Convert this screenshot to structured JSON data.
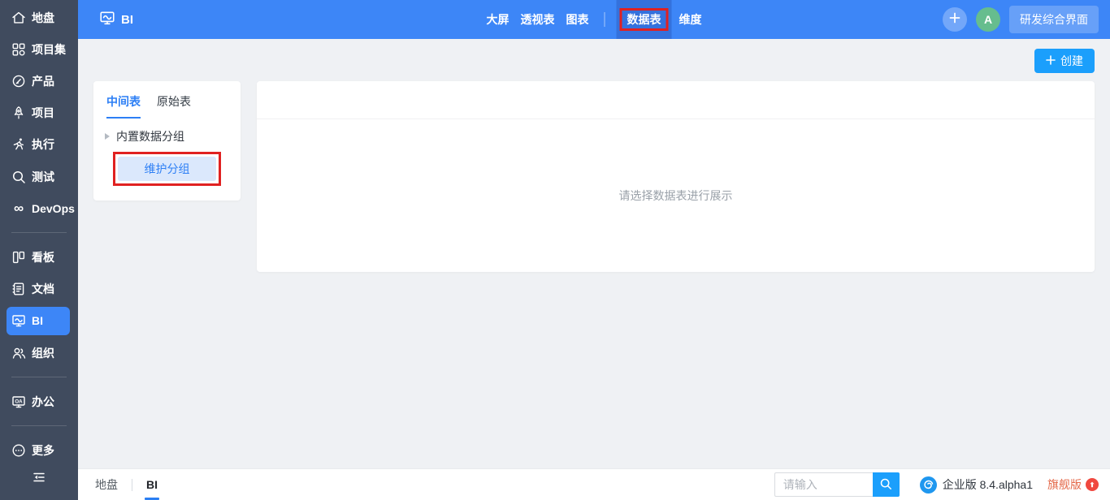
{
  "colors": {
    "topbar_blue": "#3d86f7",
    "topbar_active_blue": "#3471dd",
    "sidebar_dark": "#404b5e",
    "accent_blue": "#2d7ff5",
    "bright_blue": "#1b9ffc",
    "annotation_red": "#e02121",
    "avatar_green": "#66bd8e",
    "upgrade_badge_red": "#f0483f",
    "upgrade_text_orange": "#e4694a"
  },
  "sidebar": {
    "items": [
      {
        "label": "地盘",
        "icon": "home-icon"
      },
      {
        "label": "项目集",
        "icon": "project-set-icon"
      },
      {
        "label": "产品",
        "icon": "product-icon"
      },
      {
        "label": "项目",
        "icon": "project-rocket-icon"
      },
      {
        "label": "执行",
        "icon": "execution-runner-icon"
      },
      {
        "label": "测试",
        "icon": "test-magnifier-icon"
      },
      {
        "label": "DevOps",
        "icon": "devops-infinity-icon",
        "glyph": "∞"
      },
      {
        "label": "看板",
        "icon": "kanban-icon"
      },
      {
        "label": "文档",
        "icon": "document-icon"
      },
      {
        "label": "BI",
        "icon": "bi-monitor-icon",
        "active": true
      },
      {
        "label": "组织",
        "icon": "org-people-icon"
      },
      {
        "label": "办公",
        "icon": "office-monitor-icon",
        "icon_text": "OA"
      },
      {
        "label": "更多",
        "icon": "more-ellipsis-icon"
      }
    ],
    "collapse_icon": "menu-fold-icon"
  },
  "header": {
    "app_label": "BI",
    "app_icon": "bi-monitor-icon",
    "nav_items": [
      {
        "label": "大屏"
      },
      {
        "label": "透视表"
      },
      {
        "label": "图表"
      },
      {
        "label": "数据表",
        "active": true,
        "annotated": true
      },
      {
        "label": "维度"
      }
    ],
    "avatar_text": "A",
    "workspace_button": "研发综合界面"
  },
  "content": {
    "create_button": "创建",
    "panel": {
      "tabs": [
        {
          "label": "中间表",
          "active": true
        },
        {
          "label": "原始表"
        }
      ],
      "tree_item": "内置数据分组",
      "maintain_button": "维护分组"
    },
    "empty_text": "请选择数据表进行展示"
  },
  "footer": {
    "breadcrumb": [
      {
        "label": "地盘"
      },
      {
        "label": "BI",
        "active": true
      }
    ],
    "search_placeholder": "请输入",
    "edition": "企业版 8.4.alpha1",
    "upgrade_label": "旗舰版"
  }
}
